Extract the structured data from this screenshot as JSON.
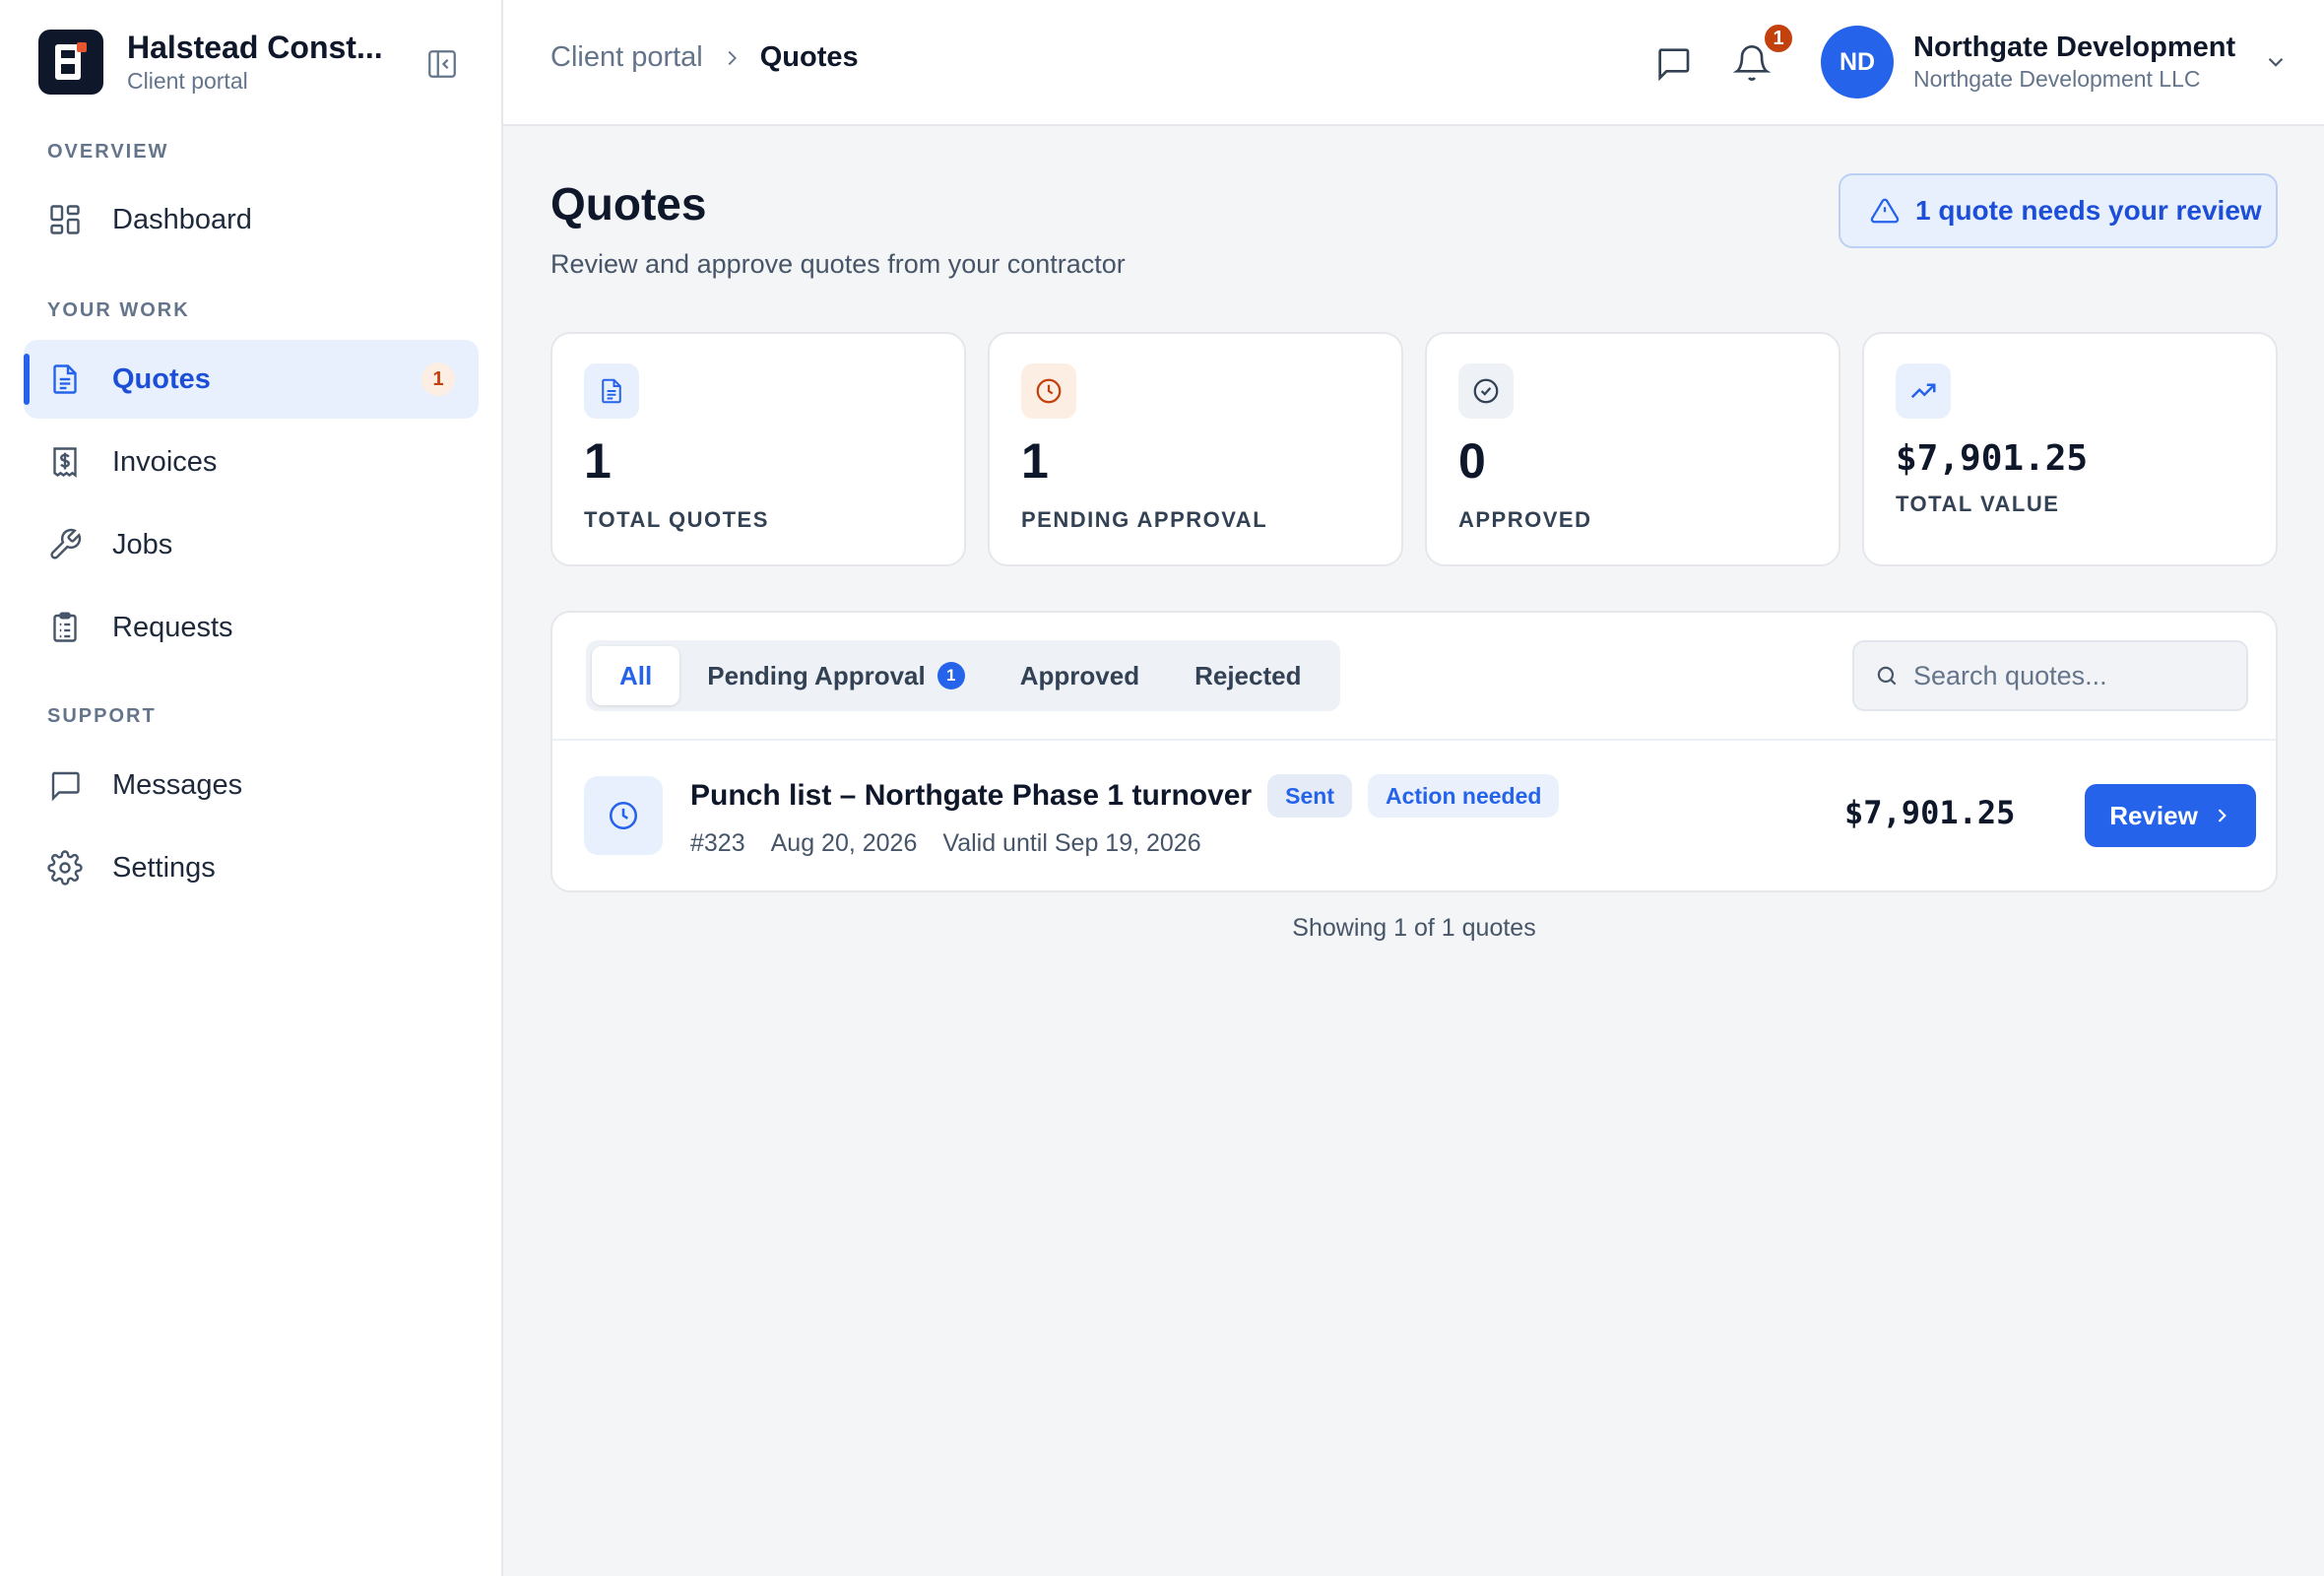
{
  "brand": {
    "name": "Halstead Const...",
    "subtitle": "Client portal"
  },
  "sidebar": {
    "sections": [
      {
        "title": "OVERVIEW"
      },
      {
        "title": "YOUR WORK"
      },
      {
        "title": "SUPPORT"
      }
    ],
    "items": [
      {
        "label": "Dashboard",
        "icon": "grid-icon"
      },
      {
        "label": "Quotes",
        "icon": "document-icon",
        "active": true,
        "badge": "1"
      },
      {
        "label": "Invoices",
        "icon": "receipt-dollar-icon"
      },
      {
        "label": "Jobs",
        "icon": "wrench-icon"
      },
      {
        "label": "Requests",
        "icon": "clipboard-icon"
      },
      {
        "label": "Messages",
        "icon": "chat-icon"
      },
      {
        "label": "Settings",
        "icon": "gear-icon"
      }
    ]
  },
  "header": {
    "breadcrumb_root": "Client portal",
    "breadcrumb_current": "Quotes",
    "notification_count": "1",
    "account": {
      "initials": "ND",
      "name": "Northgate Development",
      "org": "Northgate Development LLC"
    }
  },
  "page": {
    "title": "Quotes",
    "subtitle": "Review and approve quotes from your contractor",
    "alert": "1 quote needs your review"
  },
  "stats": [
    {
      "value": "1",
      "label": "TOTAL QUOTES",
      "icon": "document-icon",
      "color": "#2563eb",
      "bg": "#e8f0fe"
    },
    {
      "value": "1",
      "label": "PENDING APPROVAL",
      "icon": "clock-icon",
      "color": "#c2410c",
      "bg": "#fdeee4"
    },
    {
      "value": "0",
      "label": "APPROVED",
      "icon": "check-circle-icon",
      "color": "#334155",
      "bg": "#eef1f5"
    },
    {
      "value": "$7,901.25",
      "label": "TOTAL VALUE",
      "icon": "trending-up-icon",
      "color": "#2563eb",
      "bg": "#e8f0fe"
    }
  ],
  "filters": {
    "tabs": [
      {
        "label": "All",
        "active": true
      },
      {
        "label": "Pending Approval",
        "badge": "1"
      },
      {
        "label": "Approved"
      },
      {
        "label": "Rejected"
      }
    ],
    "search_placeholder": "Search quotes..."
  },
  "quotes": [
    {
      "title": "Punch list – Northgate Phase 1 turnover",
      "status": "Sent",
      "flag": "Action needed",
      "number": "#323",
      "date": "Aug 20, 2026",
      "valid_until": "Valid until Sep 19, 2026",
      "amount": "$7,901.25",
      "action": "Review"
    }
  ],
  "footer": {
    "showing": "Showing 1 of 1 quotes"
  },
  "colors": {
    "accent": "#2563eb",
    "warning": "#c2410c",
    "background": "#f4f5f7"
  }
}
